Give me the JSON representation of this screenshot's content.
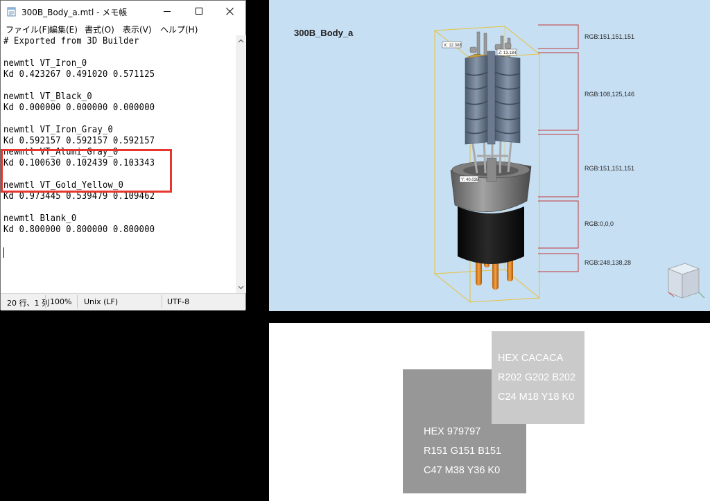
{
  "notepad": {
    "title": "300B_Body_a.mtl - メモ帳",
    "menu": [
      "ファイル(F)",
      "編集(E)",
      "書式(O)",
      "表示(V)",
      "ヘルプ(H)"
    ],
    "lines": [
      "# Exported from 3D Builder",
      "",
      "newmtl VT_Iron_0",
      "Kd 0.423267 0.491020 0.571125",
      "",
      "newmtl VT_Black_0",
      "Kd 0.000000 0.000000 0.000000",
      "",
      "newmtl VT_Iron_Gray_0",
      "Kd 0.592157 0.592157 0.592157",
      "newmtl VT_Alumi_Gray_0",
      "Kd 0.100630 0.102439 0.103343",
      "",
      "newmtl VT_Gold_Yellow_0",
      "Kd 0.973445 0.539479 0.109462",
      "",
      "newmtl Blank_0",
      "Kd 0.800000 0.800000 0.800000"
    ],
    "status": {
      "position": "20 行、1 列",
      "zoom": "100%",
      "line_ending": "Unix (LF)",
      "encoding": "UTF-8"
    },
    "highlight_color": "#e8362f"
  },
  "viewer": {
    "model_name": "300B_Body_a",
    "background_color": "#c6dff3",
    "dimensions": {
      "x": "X: 12.308",
      "z": "Z: 13.184",
      "y": "Y: 40.038"
    },
    "rgb_labels": [
      "RGB:151,151,151",
      "RGB:108,125,146",
      "RGB:151,151,151",
      "RGB:0,0,0",
      "RGB:248,138,28"
    ],
    "view_cube_icon": "view-cube-icon"
  },
  "swatches": {
    "light": {
      "color": "#cacaca",
      "hex": "HEX CACACA",
      "rgb": "R202 G202 B202",
      "cmyk": "C24 M18 Y18 K0"
    },
    "dark": {
      "color": "#979797",
      "hex": "HEX 979797",
      "rgb": "R151 G151 B151",
      "cmyk": "C47 M38 Y36 K0"
    }
  }
}
